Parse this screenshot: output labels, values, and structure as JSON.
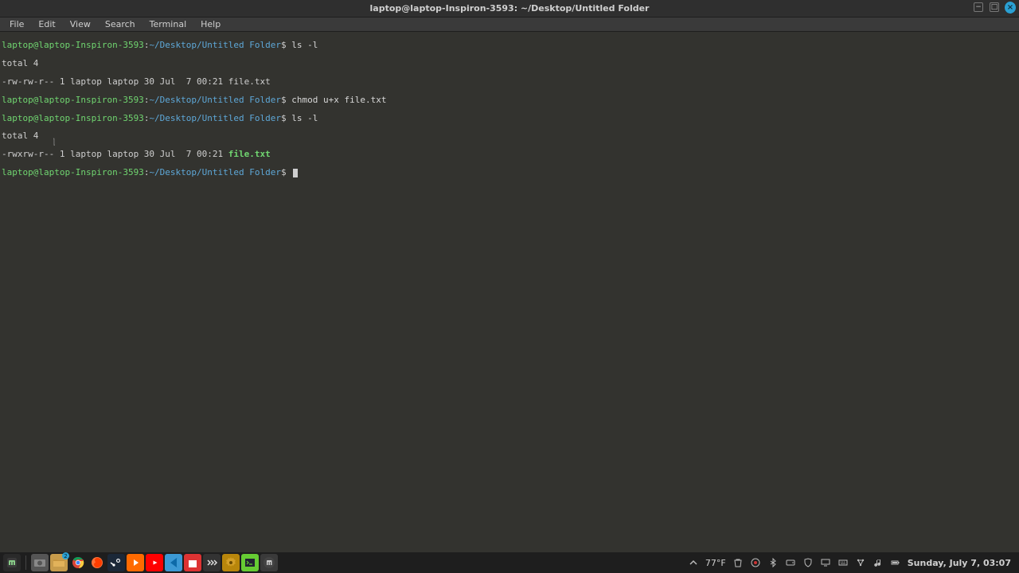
{
  "window": {
    "title": "laptop@laptop-Inspiron-3593: ~/Desktop/Untitled Folder"
  },
  "menu": {
    "items": [
      "File",
      "Edit",
      "View",
      "Search",
      "Terminal",
      "Help"
    ]
  },
  "prompt": {
    "user_host": "laptop@laptop-Inspiron-3593",
    "colon": ":",
    "path": "~/Desktop/Untitled Folder",
    "sigil": "$"
  },
  "terminal": {
    "cmd1": "ls -l",
    "out1": "total 4",
    "out2": "-rw-rw-r-- 1 laptop laptop 30 Jul  7 00:21 file.txt",
    "cmd2": "chmod u+x file.txt",
    "cmd3": "ls -l",
    "out3": "total 4",
    "out4a": "-rwxrw-r-- 1 laptop laptop 30 Jul  7 00:21 ",
    "out4b": "file.txt"
  },
  "taskbar": {
    "weather": "77°F",
    "datetime": "Sunday, July 7, 03:07",
    "update_badge": "2"
  },
  "launcher": {
    "items": [
      "start-menu",
      "screenshot-app",
      "file-manager",
      "chrome",
      "firefox",
      "steam",
      "media-player",
      "youtube",
      "vscode",
      "notes",
      "chat",
      "settings",
      "putty",
      "mint-menu"
    ]
  },
  "tray": {
    "items": [
      "caret-up",
      "weather",
      "trash",
      "obs",
      "bluetooth",
      "disk",
      "shield",
      "display",
      "keyboard",
      "network",
      "audio",
      "battery"
    ]
  },
  "colors": {
    "bg": "#33332f",
    "panel": "#1e1e1e",
    "prompt_user": "#70d570",
    "prompt_path": "#5ea8d8",
    "accent_close": "#2aa0d3"
  }
}
